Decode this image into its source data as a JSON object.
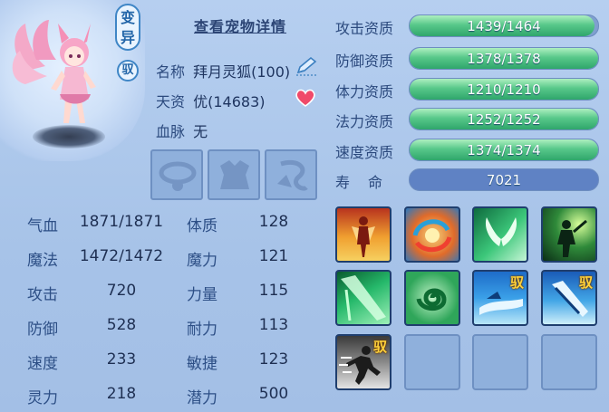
{
  "header": {
    "variant_tag": "变异",
    "ride_tag": "驭",
    "detail_link": "查看宠物详情"
  },
  "pet": {
    "name_label": "名称",
    "name_value": "拜月灵狐(100)",
    "talent_label": "天资",
    "talent_value": "优(14683)",
    "bloodline_label": "血脉",
    "bloodline_value": "无"
  },
  "equipment": [
    {
      "slot": "collar",
      "icon": "collar-icon"
    },
    {
      "slot": "armor",
      "icon": "armor-icon"
    },
    {
      "slot": "amulet",
      "icon": "amulet-icon"
    }
  ],
  "base_stats": {
    "hp": {
      "label": "气血",
      "value": "1871/1871"
    },
    "mp": {
      "label": "魔法",
      "value": "1472/1472"
    },
    "atk": {
      "label": "攻击",
      "value": "720"
    },
    "def": {
      "label": "防御",
      "value": "528"
    },
    "spd": {
      "label": "速度",
      "value": "233"
    },
    "spi": {
      "label": "灵力",
      "value": "218"
    },
    "con": {
      "label": "体质",
      "value": "128"
    },
    "mag": {
      "label": "魔力",
      "value": "121"
    },
    "str": {
      "label": "力量",
      "value": "115"
    },
    "end": {
      "label": "耐力",
      "value": "113"
    },
    "agi": {
      "label": "敏捷",
      "value": "123"
    },
    "pot": {
      "label": "潜力",
      "value": "500"
    }
  },
  "aptitudes": [
    {
      "label": "攻击资质",
      "value": "1439/1464",
      "fraction": 0.983
    },
    {
      "label": "防御资质",
      "value": "1378/1378",
      "fraction": 1.0
    },
    {
      "label": "体力资质",
      "value": "1210/1210",
      "fraction": 1.0
    },
    {
      "label": "法力资质",
      "value": "1252/1252",
      "fraction": 1.0
    },
    {
      "label": "速度资质",
      "value": "1374/1374",
      "fraction": 1.0
    }
  ],
  "lifespan": {
    "label": "寿　命",
    "value": "7021"
  },
  "skills": [
    {
      "icon": "power-surge-skill-icon",
      "badge": ""
    },
    {
      "icon": "elemental-orb-skill-icon",
      "badge": ""
    },
    {
      "icon": "wind-wings-skill-icon",
      "badge": ""
    },
    {
      "icon": "shadow-warrior-skill-icon",
      "badge": ""
    },
    {
      "icon": "green-slash-skill-icon",
      "badge": ""
    },
    {
      "icon": "spiral-skill-icon",
      "badge": ""
    },
    {
      "icon": "mount-dash-skill-icon",
      "badge": "驭"
    },
    {
      "icon": "mount-strike-skill-icon",
      "badge": "驭"
    },
    {
      "icon": "mount-sprint-skill-icon",
      "badge": "驭"
    },
    {
      "icon": "empty-slot",
      "badge": ""
    },
    {
      "icon": "empty-slot",
      "badge": ""
    },
    {
      "icon": "empty-slot",
      "badge": ""
    }
  ],
  "colors": {
    "background": "#a9c6ea",
    "bar_fill": "#3fb67a",
    "tag_border": "#3f86c6",
    "badge": "#ffd23c"
  }
}
